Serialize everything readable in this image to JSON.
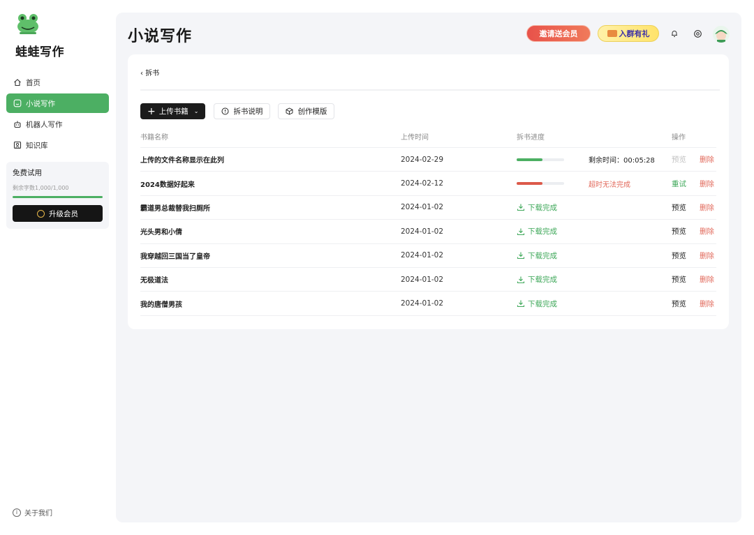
{
  "sidebar": {
    "brand": "蛙蛙写作",
    "nav": [
      {
        "label": "首页",
        "icon": "home-icon"
      },
      {
        "label": "小说写作",
        "icon": "chat-face-icon"
      },
      {
        "label": "机器人写作",
        "icon": "robot-icon"
      },
      {
        "label": "知识库",
        "icon": "knowledge-icon"
      }
    ],
    "trial": {
      "title": "免费试用",
      "words_left": "剩余字数1,000/1,000",
      "fraction": 1.0,
      "upgrade_label": "升级会员"
    },
    "about": "关于我们",
    "accent": "#4caf63"
  },
  "header": {
    "title": "小说写作",
    "promo_invite": "邀请送会员",
    "promo_group": "入群有礼"
  },
  "page": {
    "breadcrumb": "拆书",
    "buttons": {
      "upload": "上传书籍",
      "guide": "拆书说明",
      "template": "创作模版"
    },
    "columns": {
      "name": "书籍名称",
      "time": "上传时间",
      "progress": "拆书进度",
      "ops": "操作"
    },
    "rows": [
      {
        "name": "上传的文件名称显示在此列",
        "time": "2024-02-29",
        "status": "progress",
        "fraction": 0.55,
        "status_text": "剩余时间：00:05:28",
        "preview": "预览",
        "preview_enabled": false,
        "delete": "删除"
      },
      {
        "name": "2024数据好起来",
        "time": "2024-02-12",
        "status": "failed",
        "fraction": 0.55,
        "status_text": "超时无法完成",
        "preview": "重试",
        "preview_enabled": true,
        "delete": "删除"
      },
      {
        "name": "霸道男总裁替我扫厕所",
        "time": "2024-01-02",
        "status": "done",
        "status_text": "下载完成",
        "preview": "预览",
        "preview_enabled": true,
        "delete": "删除"
      },
      {
        "name": "光头男和小倩",
        "time": "2024-01-02",
        "status": "done",
        "status_text": "下载完成",
        "preview": "预览",
        "preview_enabled": true,
        "delete": "删除"
      },
      {
        "name": "我穿越回三国当了皇帝",
        "time": "2024-01-02",
        "status": "done",
        "status_text": "下载完成",
        "preview": "预览",
        "preview_enabled": true,
        "delete": "删除"
      },
      {
        "name": "无极道法",
        "time": "2024-01-02",
        "status": "done",
        "status_text": "下载完成",
        "preview": "预览",
        "preview_enabled": true,
        "delete": "删除"
      },
      {
        "name": "我的唐僧男孩",
        "time": "2024-01-02",
        "status": "done",
        "status_text": "下载完成",
        "preview": "预览",
        "preview_enabled": true,
        "delete": "删除"
      }
    ],
    "colors": {
      "success": "#3fa85a",
      "danger": "#e26a5c",
      "progress": "#4caf63",
      "failed": "#dc5a4a"
    }
  }
}
